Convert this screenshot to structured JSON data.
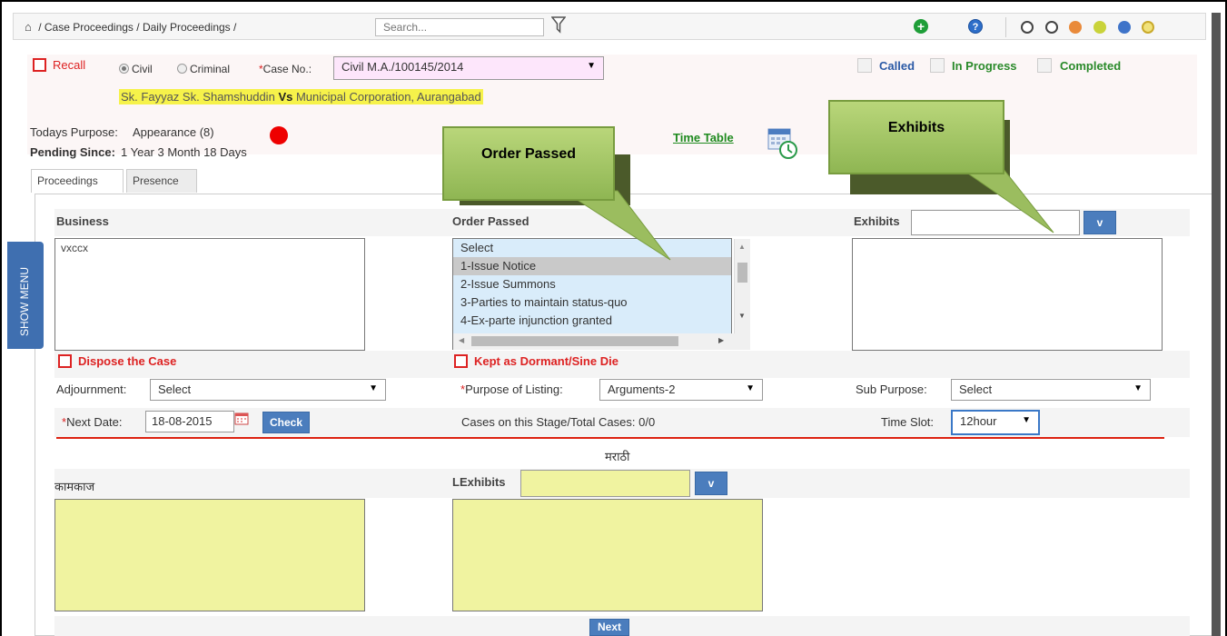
{
  "breadcrumb": {
    "home": "Home",
    "items": [
      "Case Proceedings",
      "Daily Proceedings"
    ]
  },
  "search": {
    "placeholder": "Search..."
  },
  "theme_colors": [
    "#ffffff",
    "#ffffff",
    "#e98a3a",
    "#c9d33a",
    "#3f74c9",
    "#e6cf3a"
  ],
  "case": {
    "recall_label": "Recall",
    "civil_label": "Civil",
    "criminal_label": "Criminal",
    "case_no_label": "Case No.:",
    "case_no_value": "Civil M.A./100145/2014",
    "parties_left": "Sk. Fayyaz Sk. Shamshuddin",
    "vs": "Vs",
    "parties_right": "Municipal Corporation, Aurangabad"
  },
  "status": {
    "called": "Called",
    "in_progress": "In Progress",
    "completed": "Completed"
  },
  "summary": {
    "todays_purpose_label": "Todays Purpose:",
    "todays_purpose_value": "Appearance (8)",
    "pending_since_label": "Pending Since:",
    "pending_since_value": "1 Year 3 Month 18 Days",
    "time_table": "Time Table"
  },
  "tabs": [
    "Proceedings",
    "Presence"
  ],
  "callouts": {
    "order_passed": "Order Passed",
    "exhibits": "Exhibits"
  },
  "proceedings": {
    "business_label": "Business",
    "business_value": "vxccx",
    "order_passed_label": "Order Passed",
    "order_options": [
      "Select",
      "1-Issue Notice",
      "2-Issue Summons",
      "3-Parties to maintain status-quo",
      "4-Ex-parte injunction granted"
    ],
    "exhibits_label": "Exhibits",
    "dropdown_btn": "v",
    "dispose_label": "Dispose the Case",
    "dormant_label": "Kept as Dormant/Sine Die",
    "adjournment_label": "Adjournment:",
    "adjournment_value": "Select",
    "purpose_label": "Purpose of Listing:",
    "purpose_value": "Arguments-2",
    "sub_purpose_label": "Sub Purpose:",
    "sub_purpose_value": "Select",
    "next_date_label": "Next Date:",
    "next_date_value": "18-08-2015",
    "check_btn": "Check",
    "cases_stage_label": "Cases on this Stage/Total Cases:",
    "cases_stage_value": "0/0",
    "time_slot_label": "Time Slot:",
    "time_slot_value": "12hour",
    "marathi_heading": "मराठी",
    "kamkaj_label": "कामकाज",
    "lexhibits_label": "LExhibits",
    "next_btn": "Next"
  },
  "show_menu": "SHOW MENU"
}
